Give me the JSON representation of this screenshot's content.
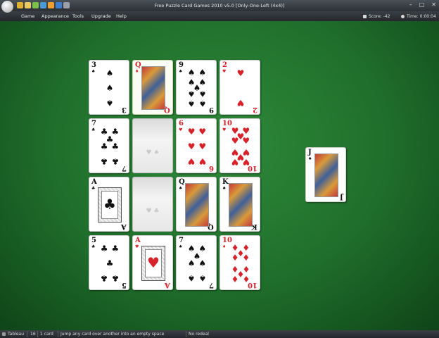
{
  "window": {
    "title": "Free Puzzle Card Games 2010 v5.0  [Only-One-Left (4x4)]",
    "controls": [
      "–",
      "□",
      "✕"
    ]
  },
  "quick_access": {
    "icons": [
      "new-game-icon",
      "open-icon",
      "pencil-icon",
      "hint-icon",
      "star-icon",
      "help-icon",
      "customize-icon"
    ],
    "colors": [
      "#e0b030",
      "#e8c860",
      "#7cc04a",
      "#4a9ad8",
      "#f0a030",
      "#3c7fd0",
      "#9aa0a8"
    ]
  },
  "menu": {
    "items": [
      "Game",
      "Appearance",
      "Tools",
      "Upgrade",
      "Help"
    ]
  },
  "indicators": {
    "score_label": "Score:",
    "score_value": "-42",
    "time_label": "Time:",
    "time_value": "0:00:04"
  },
  "tableau": {
    "rows": [
      [
        {
          "kind": "pip",
          "rank": "3",
          "suit": "♠",
          "color": "black",
          "selected": false
        },
        {
          "kind": "face",
          "rank": "Q",
          "suit": "♦",
          "color": "red",
          "selected": true
        },
        {
          "kind": "pip",
          "rank": "9",
          "suit": "♠",
          "color": "black",
          "selected": false
        },
        {
          "kind": "pip",
          "rank": "2",
          "suit": "♥",
          "color": "red",
          "selected": false
        }
      ],
      [
        {
          "kind": "pip",
          "rank": "7",
          "suit": "♣",
          "color": "black",
          "selected": false
        },
        {
          "kind": "empty",
          "slot_suits": "♥ ♠"
        },
        {
          "kind": "pip",
          "rank": "6",
          "suit": "♥",
          "color": "red",
          "selected": false
        },
        {
          "kind": "pip",
          "rank": "10",
          "suit": "♥",
          "color": "red",
          "selected": false
        }
      ],
      [
        {
          "kind": "ace",
          "rank": "A",
          "suit": "♣",
          "color": "black",
          "selected": false
        },
        {
          "kind": "empty",
          "slot_suits": "♥ ♣"
        },
        {
          "kind": "face",
          "rank": "Q",
          "suit": "♠",
          "color": "black",
          "selected": false
        },
        {
          "kind": "face",
          "rank": "K",
          "suit": "♠",
          "color": "black",
          "selected": false
        }
      ],
      [
        {
          "kind": "pip",
          "rank": "5",
          "suit": "♣",
          "color": "black",
          "selected": false
        },
        {
          "kind": "ace",
          "rank": "A",
          "suit": "♥",
          "color": "red",
          "selected": false
        },
        {
          "kind": "pip",
          "rank": "7",
          "suit": "♠",
          "color": "black",
          "selected": false
        },
        {
          "kind": "pip",
          "rank": "10",
          "suit": "♦",
          "color": "red",
          "selected": false
        }
      ]
    ]
  },
  "stock_card": {
    "kind": "face",
    "rank": "J",
    "suit": "♠",
    "color": "black"
  },
  "status": {
    "tableau_label": "Tableau",
    "count": "16",
    "cards": "1 card",
    "hint": "Jump any card over another into an empty space",
    "redeal": "No redeal"
  },
  "colors": {
    "felt": "#1f6e2b",
    "red_suit": "#d8222a",
    "black_suit": "#111111"
  }
}
